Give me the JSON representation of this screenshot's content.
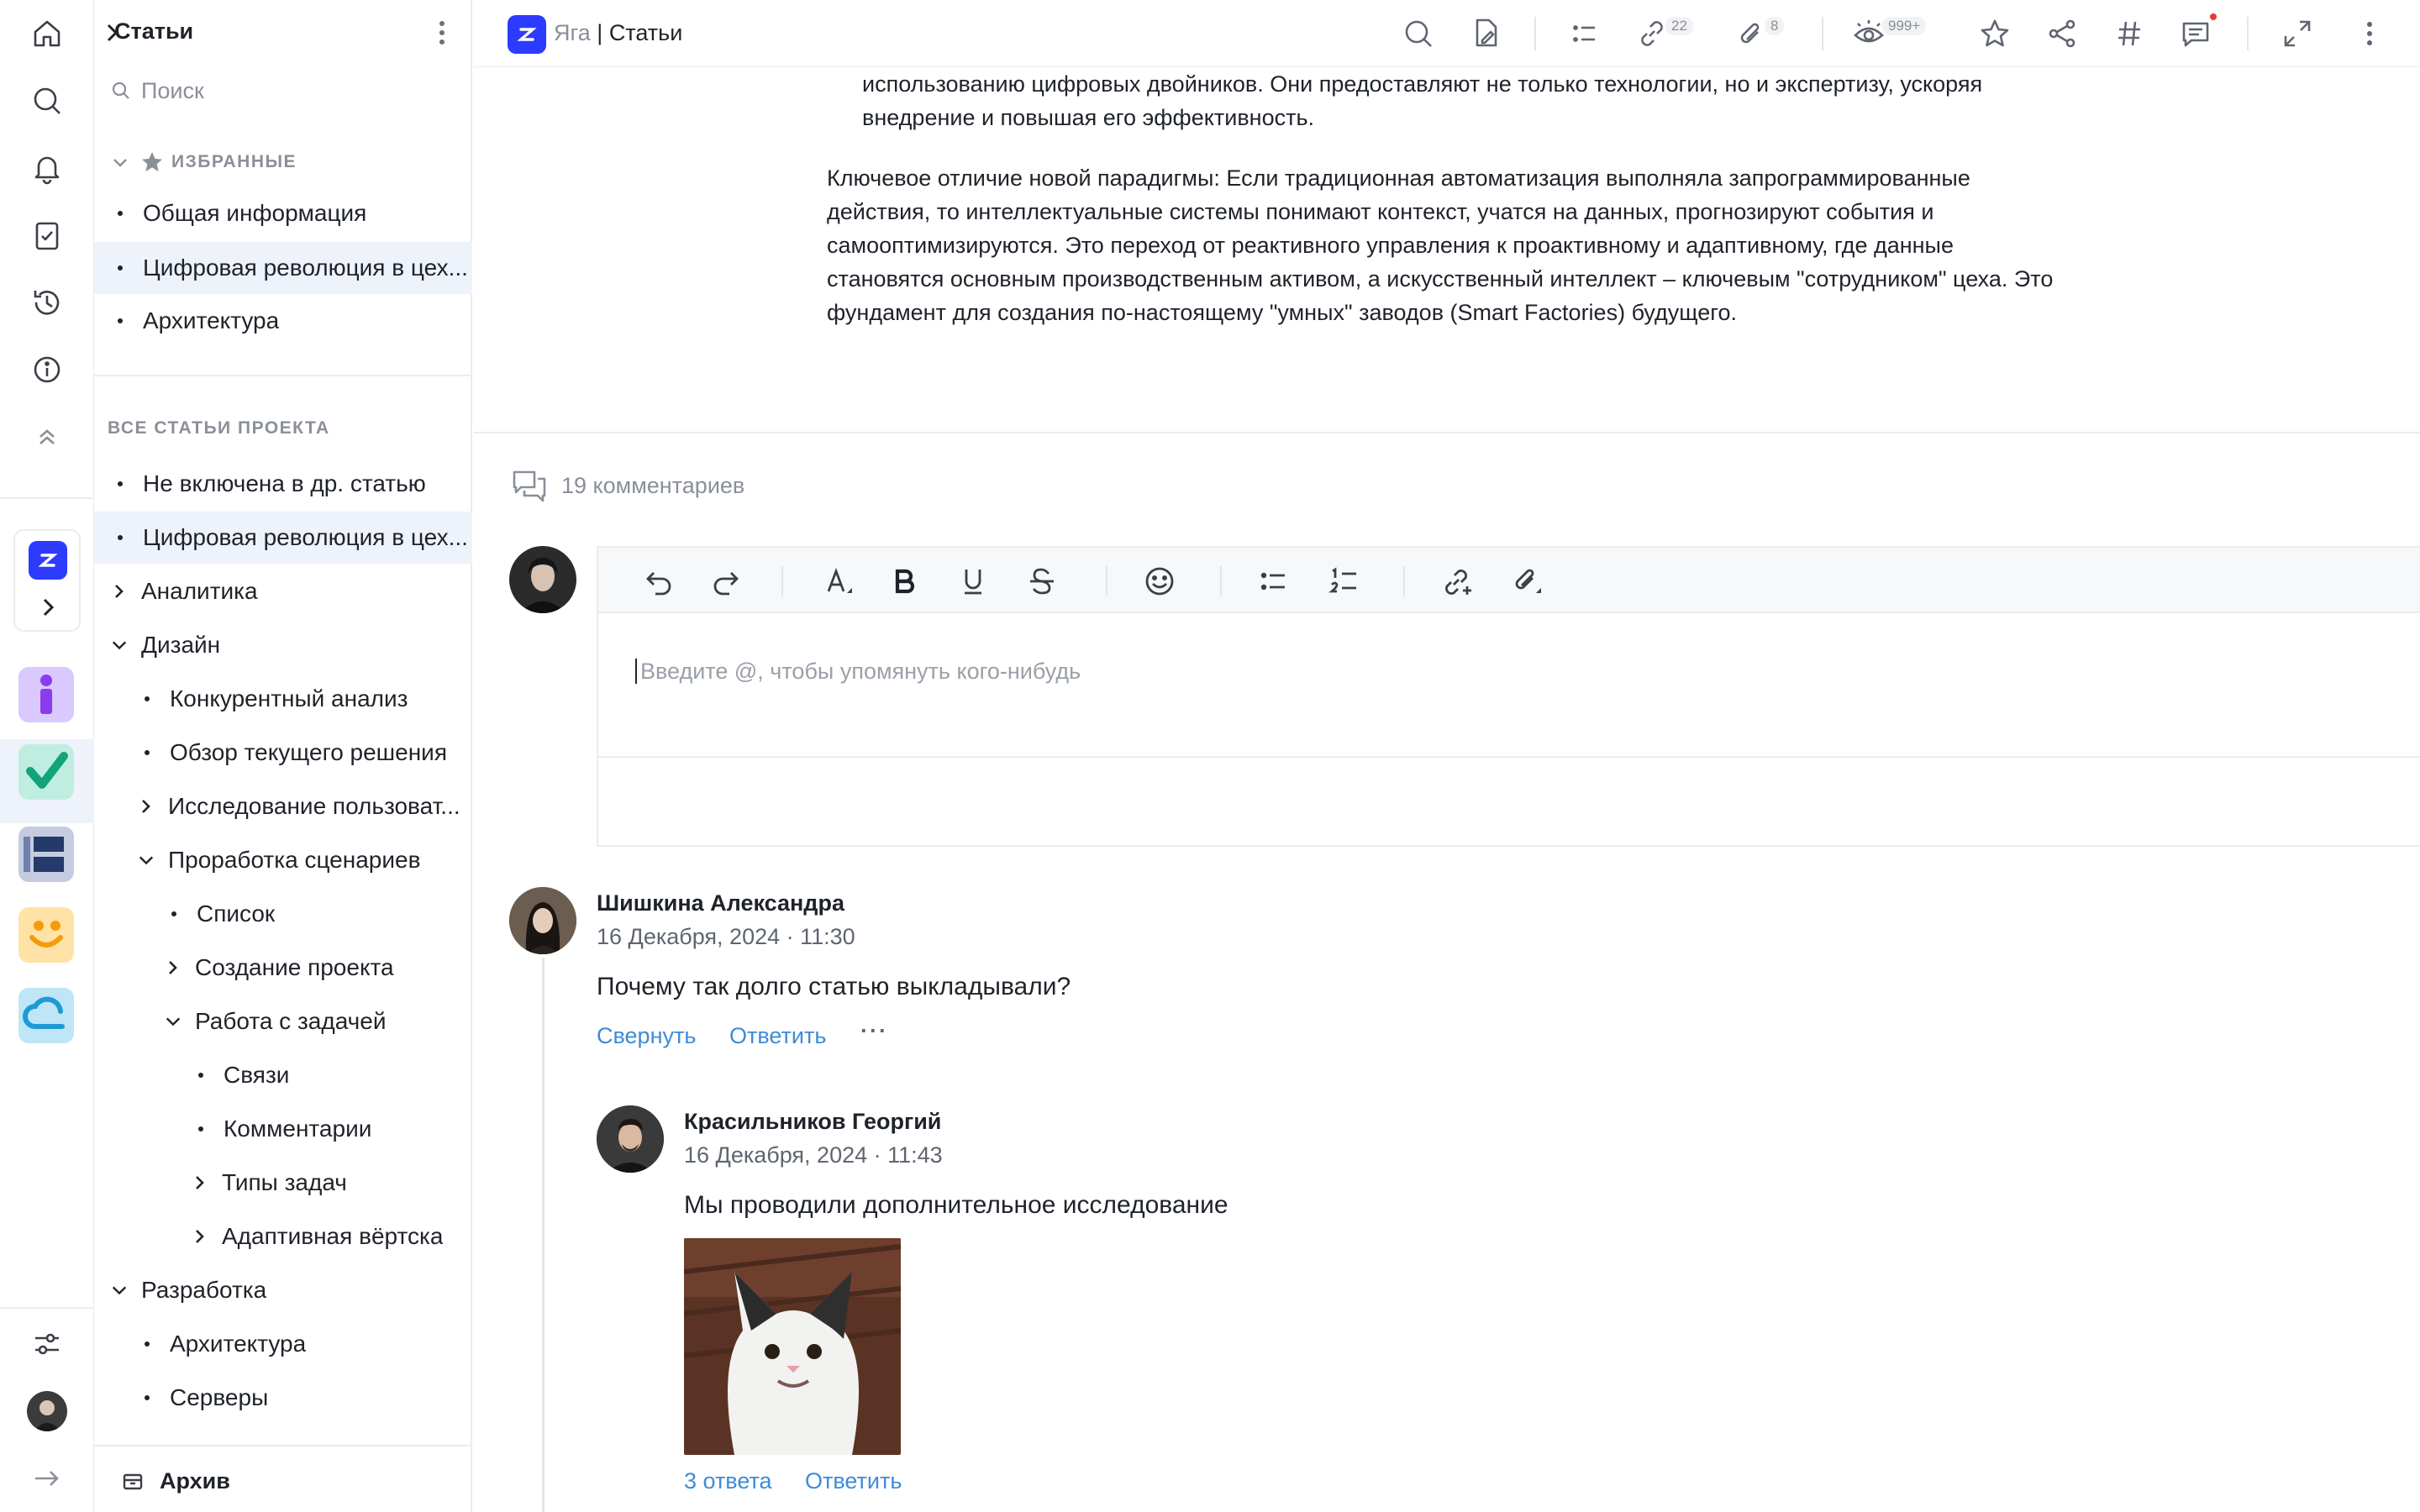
{
  "sidebar": {
    "title": "Статьи",
    "search_placeholder": "Поиск",
    "favorites_label": "ИЗБРАННЫЕ",
    "favorites": [
      {
        "label": "Общая информация"
      },
      {
        "label": "Цифровая революция в цех..."
      },
      {
        "label": "Архитектура"
      }
    ],
    "all_label": "ВСЕ СТАТЬИ ПРОЕКТА",
    "tree": [
      {
        "label": "Не включена в др. статью"
      },
      {
        "label": "Цифровая революция в цех..."
      },
      {
        "label": "Аналитика"
      },
      {
        "label": "Дизайн"
      },
      {
        "label": "Конкурентный анализ"
      },
      {
        "label": "Обзор текущего решения"
      },
      {
        "label": "Исследование пользоват..."
      },
      {
        "label": "Проработка сценариев"
      },
      {
        "label": "Список"
      },
      {
        "label": "Создание проекта"
      },
      {
        "label": "Работа с задачей"
      },
      {
        "label": "Связи"
      },
      {
        "label": "Комментарии"
      },
      {
        "label": "Типы задач"
      },
      {
        "label": "Адаптивная вёртска"
      },
      {
        "label": "Разработка"
      },
      {
        "label": "Архитектура"
      },
      {
        "label": "Серверы"
      }
    ],
    "archive_label": "Архив"
  },
  "topbar": {
    "project": "Яга",
    "separator": " | ",
    "section": "Статьи",
    "links_count": "22",
    "attachments_count": "8",
    "views_count": "999+"
  },
  "article": {
    "bullet_tail": "использованию цифровых двойников. Они предоставляют не только технологии, но и экспертизу, ускоряя внедрение и повышая его эффективность.",
    "paragraph": "Ключевое отличие новой парадигмы: Если традиционная автоматизация выполняла запрограммированные действия, то интеллектуальные системы понимают контекст, учатся на данных, прогнозируют события и самооптимизируются. Это переход от реактивного управления к проактивному и адаптивному, где данные становятся основным производственным активом, а искусственный интеллект – ключевым \"сотрудником\" цеха. Это фундамент для создания по-настоящему \"умных\" заводов (Smart Factories) будущего."
  },
  "comments": {
    "count_label": "19 комментариев",
    "editor_placeholder": "Введите @, чтобы упомянуть кого-нибудь",
    "items": [
      {
        "author": "Шишкина Александра",
        "date": "16 Декабря, 2024 · 11:30",
        "text": "Почему так долго статью выкладывали?",
        "collapse_label": "Свернуть",
        "reply_label": "Ответить",
        "more_label": "···"
      },
      {
        "author": "Красильников Георгий",
        "date": "16 Декабря, 2024 · 11:43",
        "text": "Мы проводили дополнительное исследование",
        "replies_label": "3 ответа",
        "reply_label": "Ответить"
      }
    ]
  },
  "colors": {
    "accent": "#2d3bff",
    "link": "#3f8bd6",
    "active_row": "#eef2fa",
    "notification_dot": "#e53935"
  }
}
